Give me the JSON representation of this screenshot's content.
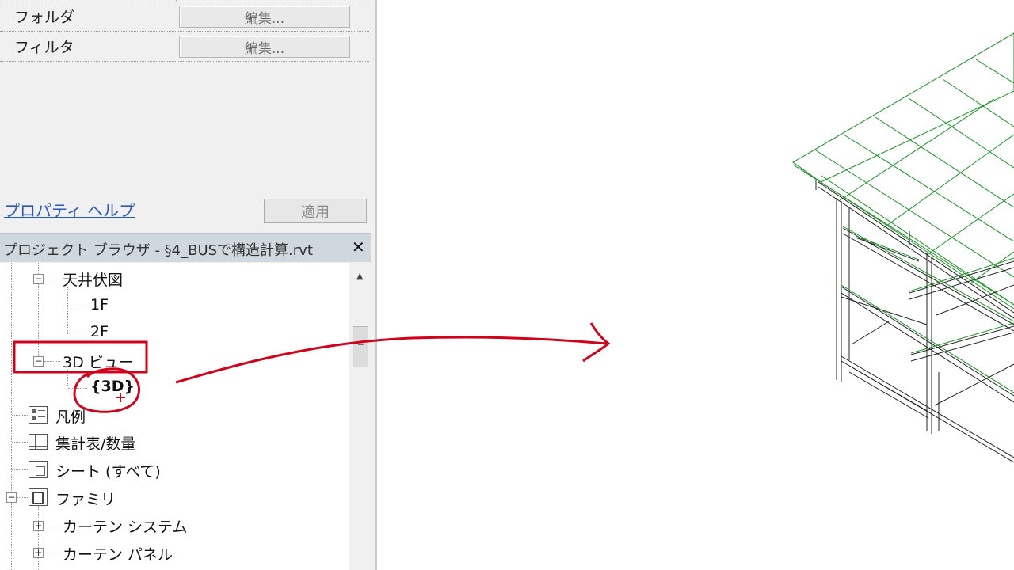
{
  "properties": {
    "rows": [
      {
        "label": "フォルダ",
        "button": "編集..."
      },
      {
        "label": "フィルタ",
        "button": "編集..."
      }
    ],
    "help_link": "プロパティ ヘルプ",
    "apply_button": "適用"
  },
  "project_browser": {
    "title": "プロジェクト ブラウザ - §4_BUSで構造計算.rvt",
    "close_glyph": "✕",
    "tree": {
      "ceiling_plans": "天井伏図",
      "ceiling_1f": "1F",
      "ceiling_2f": "2F",
      "views_3d": "3D ビュー",
      "view_3d_item": "{3D}",
      "legends": "凡例",
      "schedules": "集計表/数量",
      "sheets": "シート (すべて)",
      "families": "ファミリ",
      "curtain_systems": "カーテン システム",
      "curtain_panels": "カーテン パネル",
      "collapse_glyph": "−",
      "expand_glyph": "+"
    }
  },
  "colors": {
    "annotation_red": "#d0021b",
    "model_green": "#1f8f2a",
    "link_blue": "#2a5ab8"
  }
}
